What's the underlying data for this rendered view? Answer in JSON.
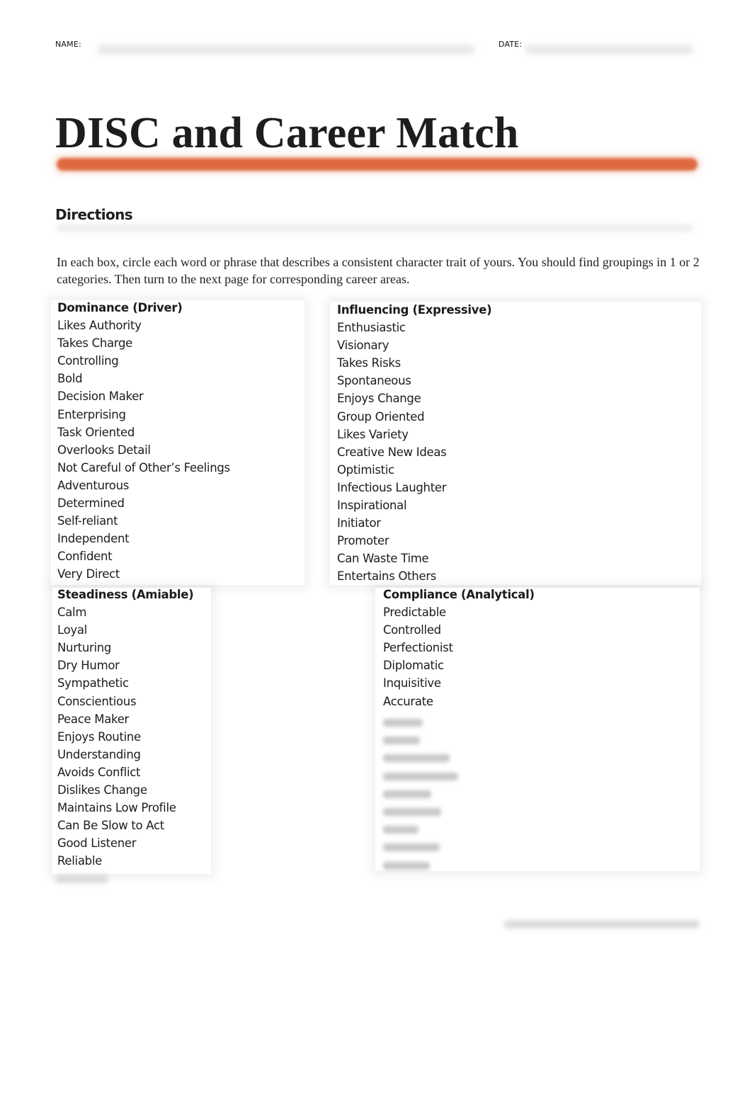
{
  "header": {
    "name_label": "NAME:",
    "date_label": "DATE:"
  },
  "title": "DISC and Career Match",
  "accent_color": "#de6b40",
  "directions": {
    "heading": "Directions",
    "text": "In each box, circle each word or phrase that describes a consistent character trait of yours. You should find groupings in 1 or 2 categories. Then turn to the next page for corresponding career areas."
  },
  "boxes": {
    "dominance": {
      "title": "Dominance (Driver)",
      "items": [
        "Likes Authority",
        "Takes Charge",
        "Controlling",
        "Bold",
        "Decision Maker",
        "Enterprising",
        "Task Oriented",
        "Overlooks Detail",
        "Not Careful of Other’s Feelings",
        "Adventurous",
        "Determined",
        "Self-reliant",
        "Independent",
        "Confident",
        "Very Direct"
      ]
    },
    "influencing": {
      "title": "Influencing (Expressive)",
      "items": [
        "Enthusiastic",
        "Visionary",
        "Takes Risks",
        "Spontaneous",
        "Enjoys Change",
        "Group Oriented",
        "Likes Variety",
        "Creative New Ideas",
        "Optimistic",
        "Infectious Laughter",
        "Inspirational",
        "Initiator",
        "Promoter",
        "Can Waste Time",
        "Entertains Others"
      ]
    },
    "steadiness": {
      "title": "Steadiness (Amiable)",
      "items": [
        "Calm",
        "Loyal",
        "Nurturing",
        "Dry Humor",
        "Sympathetic",
        "Conscientious",
        "Peace Maker",
        "Enjoys Routine",
        "Understanding",
        "Avoids Conflict",
        "Dislikes Change",
        "Maintains Low Profile",
        "Can Be Slow to Act",
        "Good Listener",
        "Reliable"
      ]
    },
    "compliance": {
      "title": "Compliance (Analytical)",
      "items": [
        "Predictable",
        "Controlled",
        "Perfectionist",
        "Diplomatic",
        "Inquisitive",
        "Accurate"
      ],
      "blurred_item_count": 9
    }
  }
}
